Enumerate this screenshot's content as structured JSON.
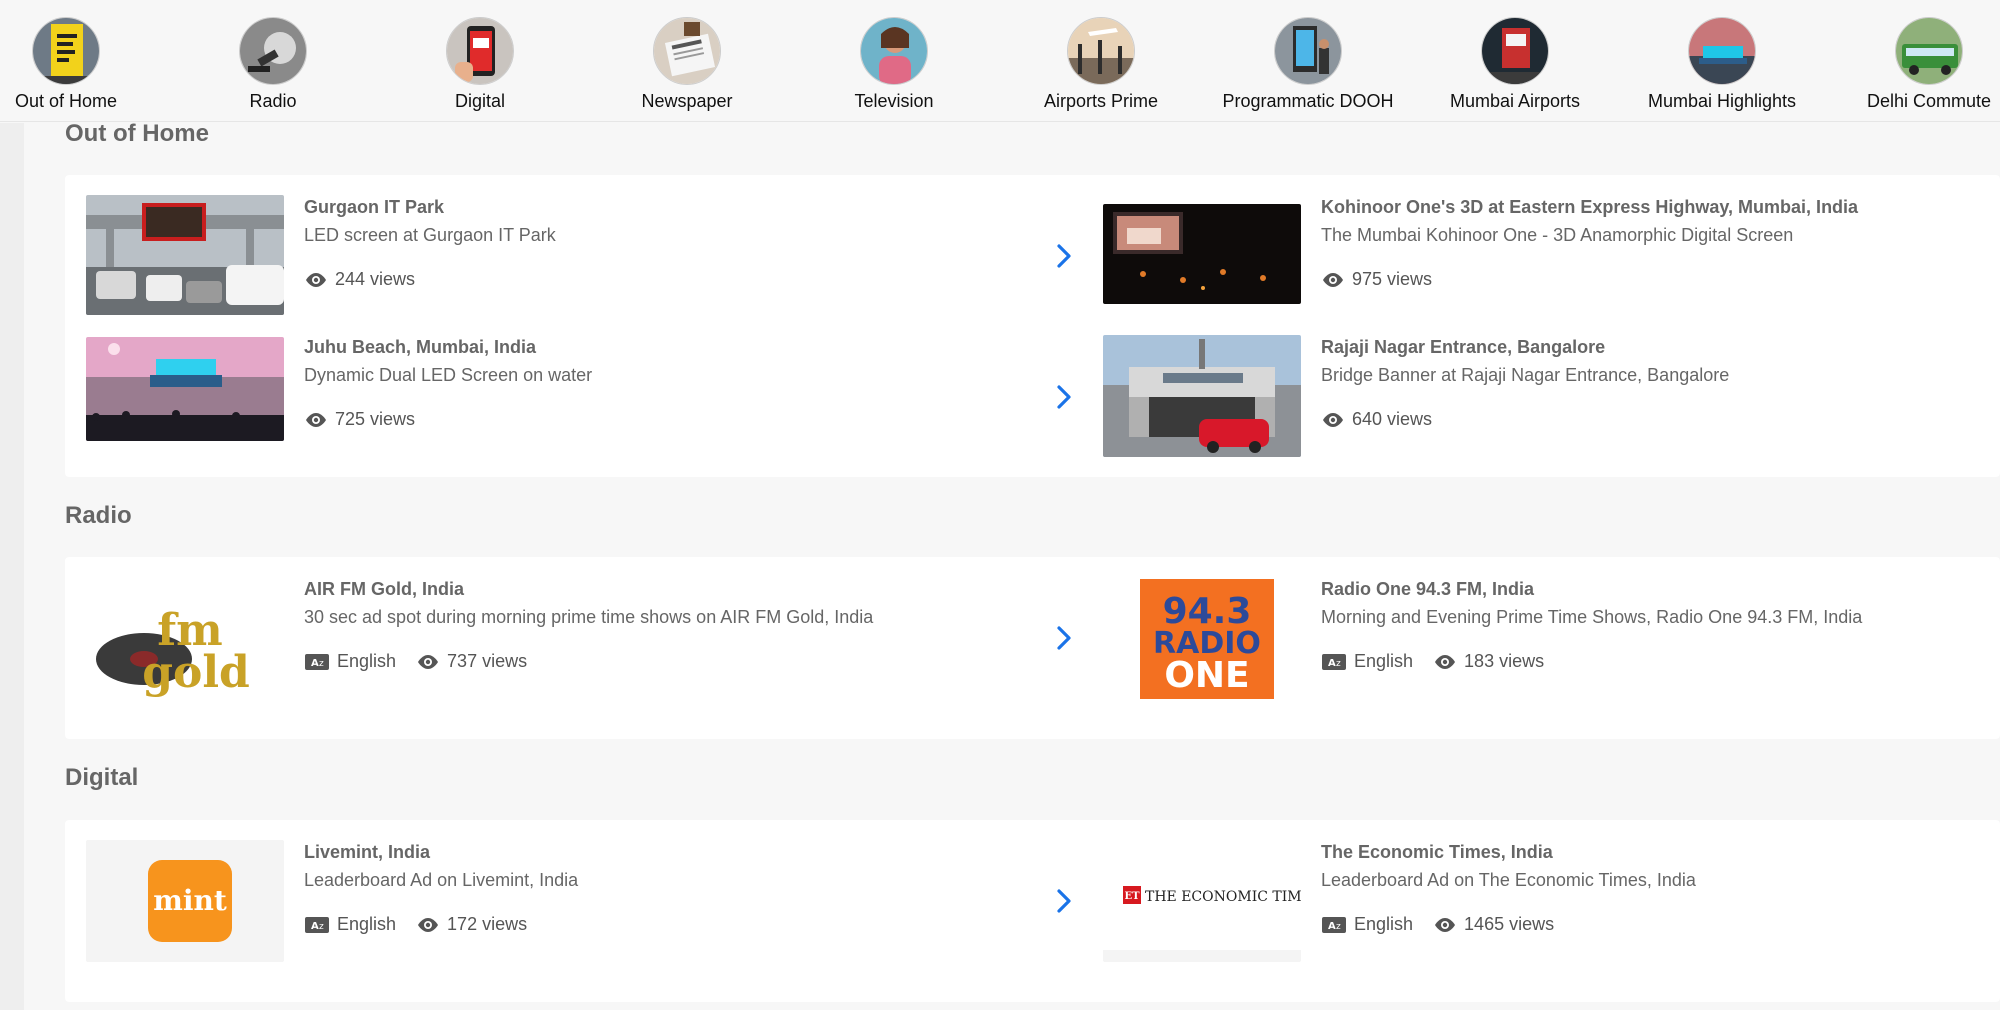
{
  "categories": [
    {
      "label": "Out of Home"
    },
    {
      "label": "Radio"
    },
    {
      "label": "Digital"
    },
    {
      "label": "Newspaper"
    },
    {
      "label": "Television"
    },
    {
      "label": "Airports Prime"
    },
    {
      "label": "Programmatic DOOH"
    },
    {
      "label": "Mumbai Airports"
    },
    {
      "label": "Mumbai Highlights"
    },
    {
      "label": "Delhi Commute"
    }
  ],
  "sections": {
    "ooh": {
      "title": "Out of Home",
      "items": [
        {
          "title": "Gurgaon IT Park",
          "desc": "LED screen at Gurgaon IT Park",
          "views": "244 views"
        },
        {
          "title": "Kohinoor One's 3D at Eastern Express Highway, Mumbai, India",
          "desc": "The Mumbai Kohinoor One - 3D Anamorphic Digital Screen",
          "views": "975 views"
        },
        {
          "title": "Juhu Beach, Mumbai, India",
          "desc": "Dynamic Dual LED Screen on water",
          "views": "725 views"
        },
        {
          "title": "Rajaji Nagar Entrance, Bangalore",
          "desc": "Bridge Banner at Rajaji Nagar Entrance, Bangalore",
          "views": "640 views"
        }
      ]
    },
    "radio": {
      "title": "Radio",
      "items": [
        {
          "title": "AIR FM Gold, India",
          "desc": "30 sec ad spot during morning prime time shows on AIR FM Gold, India",
          "language": "English",
          "views": "737 views",
          "logo": "fm gold"
        },
        {
          "title": "Radio One 94.3 FM, India",
          "desc": "Morning and Evening Prime Time Shows, Radio One 94.3 FM, India",
          "language": "English",
          "views": "183 views",
          "logo_top": "94.3",
          "logo_mid": "RADIO",
          "logo_bot": "ONE"
        }
      ]
    },
    "digital": {
      "title": "Digital",
      "items": [
        {
          "title": "Livemint, India",
          "desc": "Leaderboard Ad on Livemint, India",
          "language": "English",
          "views": "172 views",
          "logo": "mint"
        },
        {
          "title": "The Economic Times, India",
          "desc": "Leaderboard Ad on The Economic Times, India",
          "language": "English",
          "views": "1465 views",
          "logo_badge": "ET",
          "logo_text": "THE ECONOMIC TIMES"
        }
      ]
    }
  },
  "colors": {
    "accent": "#1a73e8",
    "mint": "#f7941d",
    "radio_one": "#f37021",
    "et_red": "#d71920",
    "fm_gold": "#c9a227"
  }
}
